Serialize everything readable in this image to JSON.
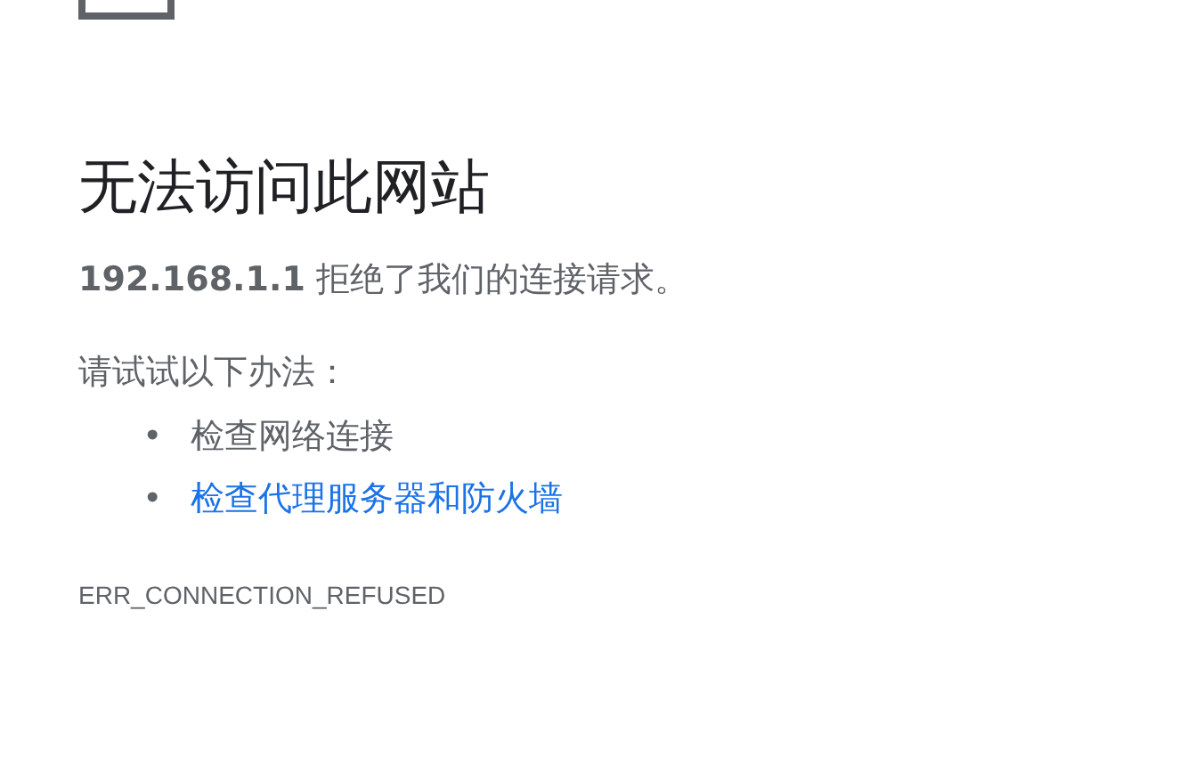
{
  "heading": "无法访问此网站",
  "message": "**192.168.1.1** 拒绝了我们的连接请求。",
  "suggestions_title": "请试试以下办法：",
  "suggestions": [
    {
      "kind": "text",
      "marker": "•",
      "text": "检查网络连接"
    },
    {
      "kind": "link",
      "marker": "•",
      "text": "检查代理服务器和防火墙"
    }
  ],
  "error_code": "ERR_CONNECTION_REFUSED"
}
